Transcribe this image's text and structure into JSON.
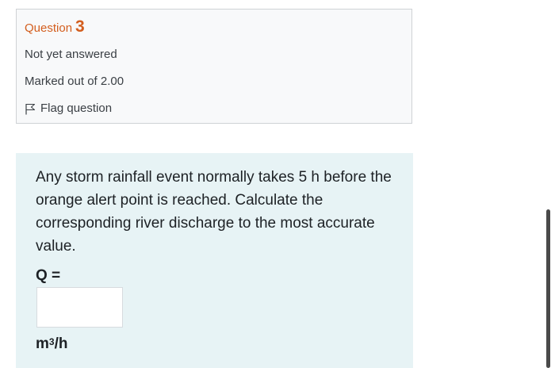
{
  "question_info": {
    "label": "Question",
    "number": "3",
    "state": "Not yet answered",
    "grade": "Marked out of 2.00",
    "flag_label": "Flag question",
    "flag_icon": "flag-outline-icon"
  },
  "formulation": {
    "text": "Any storm rainfall event normally takes 5 h before the orange alert point is reached. Calculate the corresponding river discharge to the most accurate value.",
    "variable_label": "Q =",
    "answer_value": "",
    "unit_base": "m",
    "unit_exponent": "3",
    "unit_suffix": "/h"
  },
  "colors": {
    "accent": "#d35e1e",
    "info_background": "#f8f9fa",
    "question_background": "#e7f3f5"
  }
}
